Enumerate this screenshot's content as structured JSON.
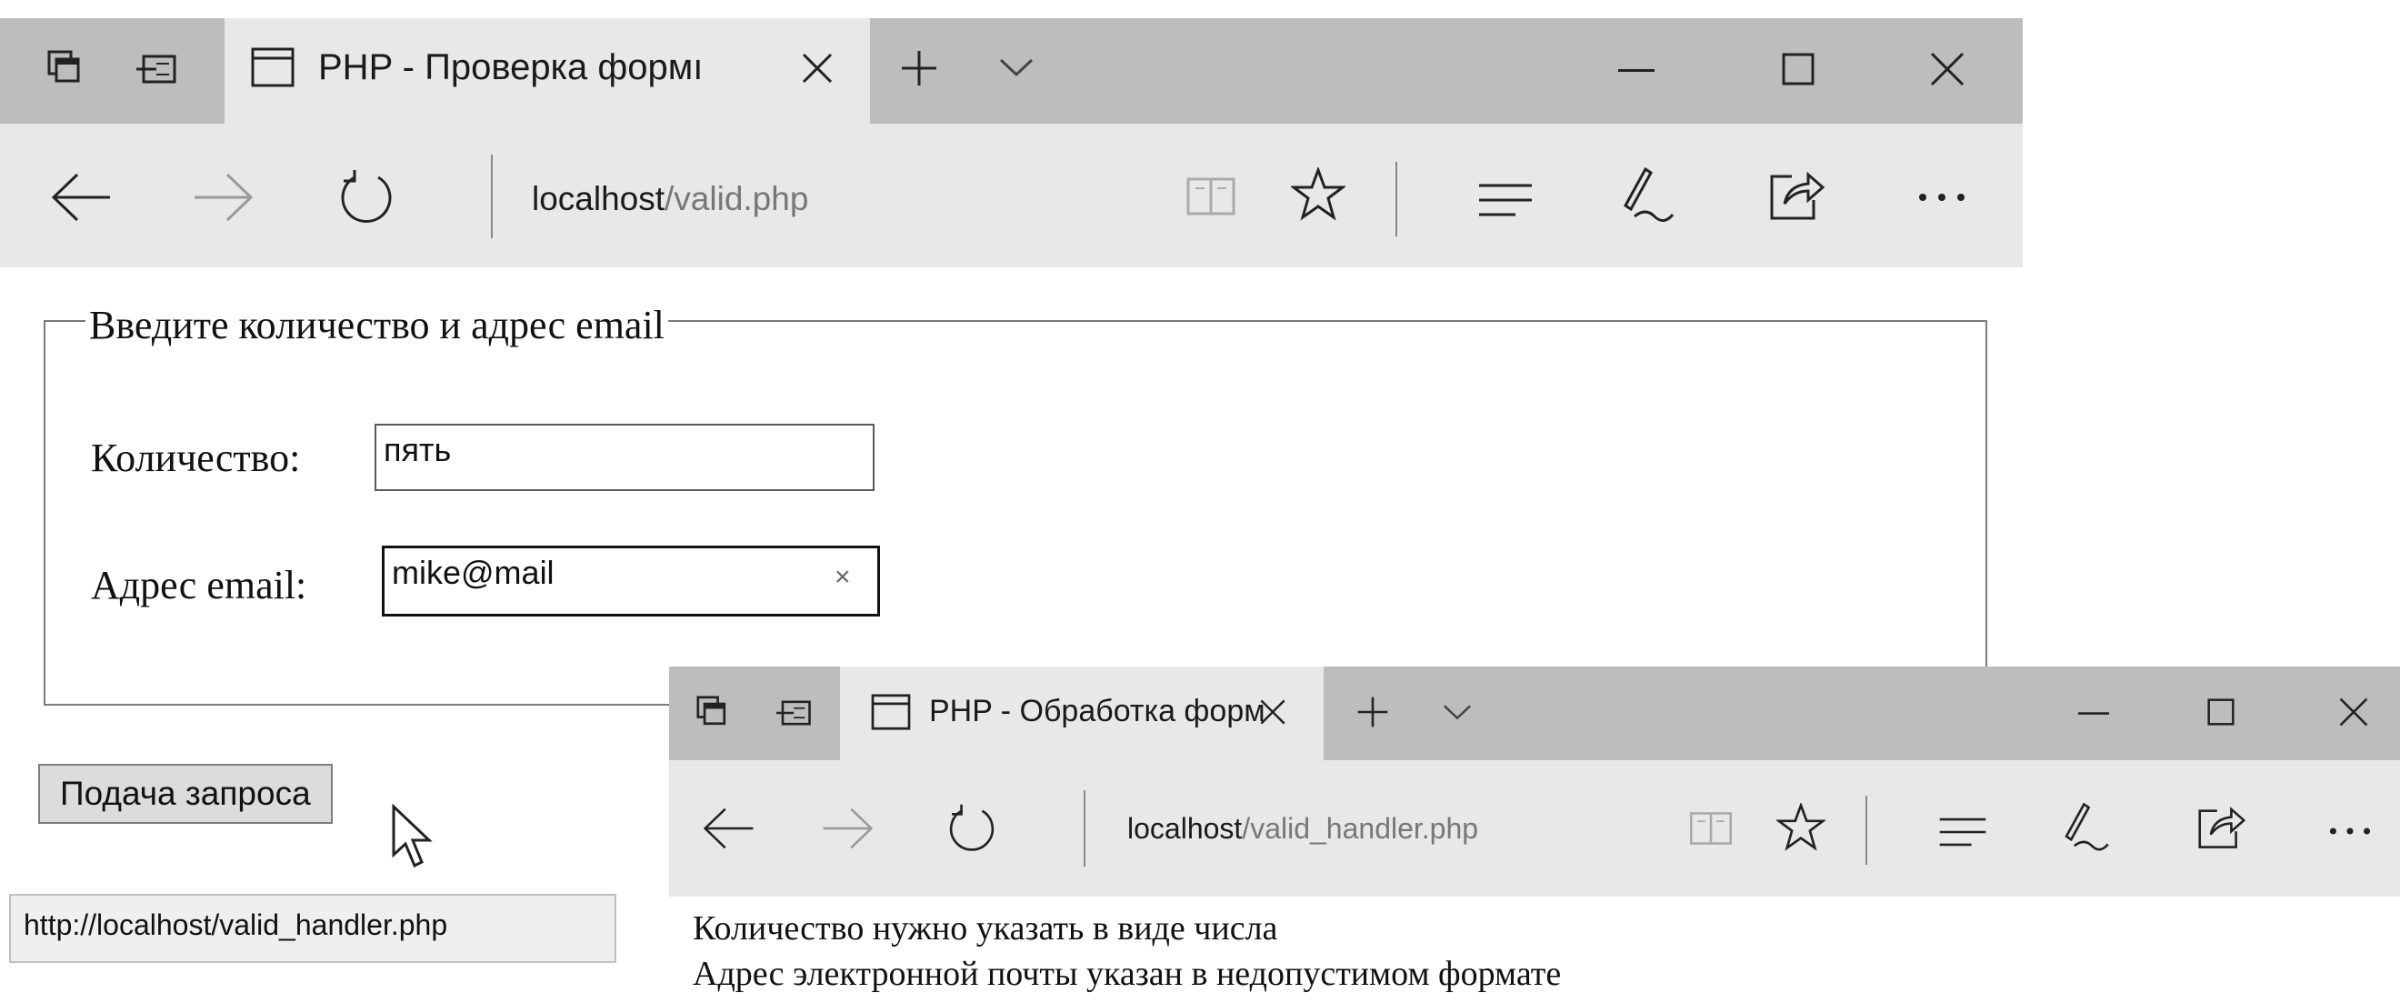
{
  "window1": {
    "tab_title": "PHP - Проверка формı",
    "url_host": "localhost",
    "url_path": "/valid.php",
    "form": {
      "legend": "Введите количество и адрес email",
      "quantity_label": "Количество:",
      "quantity_value": "пять",
      "email_label": "Адрес email:",
      "email_value": "mike@mail",
      "clear_symbol": "×",
      "submit_label": "Подача запроса"
    },
    "status_url": "http://localhost/valid_handler.php"
  },
  "window2": {
    "tab_title": "PHP - Обработка форм",
    "url_host": "localhost",
    "url_path": "/valid_handler.php",
    "messages": [
      "Количество нужно указать в виде числа",
      "Адрес электронной почты указан в недопустимом формате"
    ]
  },
  "icons": {
    "tab_actions": "tab-actions-icon",
    "set_aside": "set-aside-tabs-icon",
    "page": "page-icon",
    "close_tab": "close-tab-icon",
    "new_tab": "new-tab-icon",
    "tab_preview": "chevron-down-icon",
    "minimize": "minimize-icon",
    "maximize": "maximize-icon",
    "close_window": "close-window-icon",
    "back": "back-arrow-icon",
    "forward": "forward-arrow-icon",
    "refresh": "refresh-icon",
    "reading_view": "reading-view-icon",
    "favorite": "star-icon",
    "hub": "hub-icon",
    "web_note": "pen-icon",
    "share": "share-icon",
    "more": "more-icon"
  }
}
